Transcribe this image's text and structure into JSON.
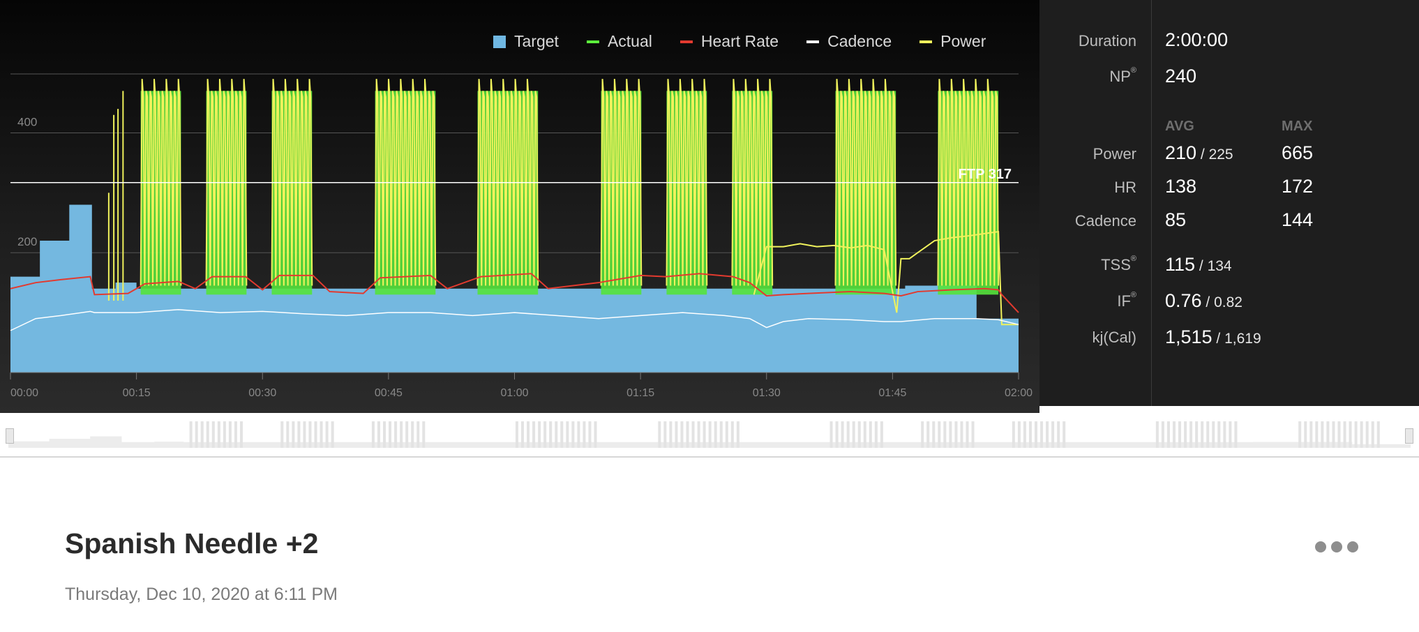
{
  "legend": [
    {
      "label": "Target",
      "color": "#6fb7e2",
      "shape": "square"
    },
    {
      "label": "Actual",
      "color": "#5cf03c",
      "shape": "line"
    },
    {
      "label": "Heart Rate",
      "color": "#e23a2f",
      "shape": "line"
    },
    {
      "label": "Cadence",
      "color": "#ffffff",
      "shape": "line"
    },
    {
      "label": "Power",
      "color": "#f0f25c",
      "shape": "line"
    }
  ],
  "stats": {
    "duration_label": "Duration",
    "duration_value": "2:00:00",
    "np_label": "NP",
    "np_mark": "®",
    "np_value": "240",
    "avg_header": "AVG",
    "max_header": "MAX",
    "power_label": "Power",
    "power_avg": "210",
    "power_sep": " / ",
    "power_avg2": "225",
    "power_max": "665",
    "hr_label": "HR",
    "hr_avg": "138",
    "hr_max": "172",
    "cadence_label": "Cadence",
    "cadence_avg": "85",
    "cadence_max": "144",
    "tss_label": "TSS",
    "tss_mark": "®",
    "tss_value": "115",
    "tss_sep": " / ",
    "tss_value2": "134",
    "if_label": "IF",
    "if_mark": "®",
    "if_value": "0.76",
    "if_sep": " / ",
    "if_value2": "0.82",
    "kj_label": "kj(Cal)",
    "kj_value": "1,515",
    "kj_sep": " / ",
    "kj_value2": "1,619"
  },
  "chart_data": {
    "type": "line",
    "x_unit": "minutes",
    "x_ticks": [
      "00:00",
      "00:15",
      "00:30",
      "00:45",
      "01:00",
      "01:15",
      "01:30",
      "01:45",
      "02:00"
    ],
    "xlim": [
      0,
      120
    ],
    "ylim": [
      0,
      510
    ],
    "y_ticks": [
      {
        "value": 200,
        "label": "200"
      },
      {
        "value": 400,
        "label": "400"
      }
    ],
    "ftp": {
      "value": 317,
      "label": "FTP 317"
    },
    "target_segments": [
      [
        0,
        3.5,
        160
      ],
      [
        3.5,
        7,
        220
      ],
      [
        7,
        9.7,
        280
      ],
      [
        9.7,
        12.5,
        140
      ],
      [
        12.5,
        15,
        150
      ],
      [
        15,
        106.5,
        140
      ],
      [
        106.5,
        115,
        145
      ],
      [
        115,
        120,
        90
      ]
    ],
    "interval_blocks": [
      {
        "start": 15.5,
        "end": 20.3,
        "cycles": 10
      },
      {
        "start": 23.3,
        "end": 28.1,
        "cycles": 10
      },
      {
        "start": 31.1,
        "end": 35.9,
        "cycles": 10
      },
      {
        "start": 43.4,
        "end": 50.6,
        "cycles": 15
      },
      {
        "start": 55.6,
        "end": 62.8,
        "cycles": 15
      },
      {
        "start": 70.3,
        "end": 75.1,
        "cycles": 10
      },
      {
        "start": 78.1,
        "end": 82.9,
        "cycles": 10
      },
      {
        "start": 85.9,
        "end": 90.7,
        "cycles": 10
      },
      {
        "start": 98.2,
        "end": 105.4,
        "cycles": 15
      },
      {
        "start": 110.4,
        "end": 117.6,
        "cycles": 15
      }
    ],
    "interval_high": 470,
    "interval_low": 130,
    "sustained_power": [
      [
        88.5,
        130
      ],
      [
        90,
        210
      ],
      [
        92,
        210
      ],
      [
        94,
        215
      ],
      [
        96,
        210
      ],
      [
        98,
        212
      ],
      [
        100,
        208
      ],
      [
        102,
        212
      ],
      [
        104,
        205
      ],
      [
        105.5,
        100
      ],
      [
        106,
        190
      ],
      [
        107,
        190
      ],
      [
        108,
        200
      ],
      [
        109,
        210
      ],
      [
        110,
        220
      ],
      [
        112,
        225
      ],
      [
        114,
        228
      ],
      [
        116,
        232
      ],
      [
        117.6,
        235
      ],
      [
        118,
        80
      ],
      [
        120,
        80
      ]
    ],
    "heart_rate": [
      [
        0,
        140
      ],
      [
        3,
        150
      ],
      [
        6,
        155
      ],
      [
        9.5,
        160
      ],
      [
        10,
        130
      ],
      [
        14,
        132
      ],
      [
        16,
        148
      ],
      [
        20,
        152
      ],
      [
        22,
        140
      ],
      [
        24,
        160
      ],
      [
        28,
        160
      ],
      [
        30,
        138
      ],
      [
        32,
        162
      ],
      [
        36,
        162
      ],
      [
        38,
        135
      ],
      [
        42,
        132
      ],
      [
        44,
        158
      ],
      [
        50,
        162
      ],
      [
        52,
        140
      ],
      [
        56,
        160
      ],
      [
        62,
        165
      ],
      [
        64,
        140
      ],
      [
        70,
        150
      ],
      [
        75,
        162
      ],
      [
        78,
        160
      ],
      [
        82,
        165
      ],
      [
        86,
        160
      ],
      [
        88,
        150
      ],
      [
        90,
        128
      ],
      [
        92,
        130
      ],
      [
        95,
        132
      ],
      [
        100,
        135
      ],
      [
        104,
        132
      ],
      [
        106,
        128
      ],
      [
        108,
        135
      ],
      [
        112,
        138
      ],
      [
        116,
        140
      ],
      [
        117.6,
        138
      ],
      [
        118,
        130
      ],
      [
        120,
        100
      ]
    ],
    "cadence": [
      [
        0,
        70
      ],
      [
        3,
        90
      ],
      [
        6,
        95
      ],
      [
        9.5,
        102
      ],
      [
        10,
        100
      ],
      [
        15,
        100
      ],
      [
        20,
        105
      ],
      [
        25,
        100
      ],
      [
        30,
        102
      ],
      [
        35,
        98
      ],
      [
        40,
        95
      ],
      [
        45,
        100
      ],
      [
        50,
        100
      ],
      [
        55,
        95
      ],
      [
        60,
        100
      ],
      [
        65,
        95
      ],
      [
        70,
        90
      ],
      [
        75,
        95
      ],
      [
        80,
        100
      ],
      [
        85,
        95
      ],
      [
        88,
        90
      ],
      [
        90,
        75
      ],
      [
        92,
        85
      ],
      [
        95,
        90
      ],
      [
        100,
        88
      ],
      [
        104,
        85
      ],
      [
        106,
        85
      ],
      [
        110,
        90
      ],
      [
        115,
        90
      ],
      [
        117.6,
        88
      ],
      [
        120,
        80
      ]
    ]
  },
  "workout": {
    "title": "Spanish Needle +2",
    "date": "Thursday, Dec 10, 2020 at 6:11 PM"
  }
}
